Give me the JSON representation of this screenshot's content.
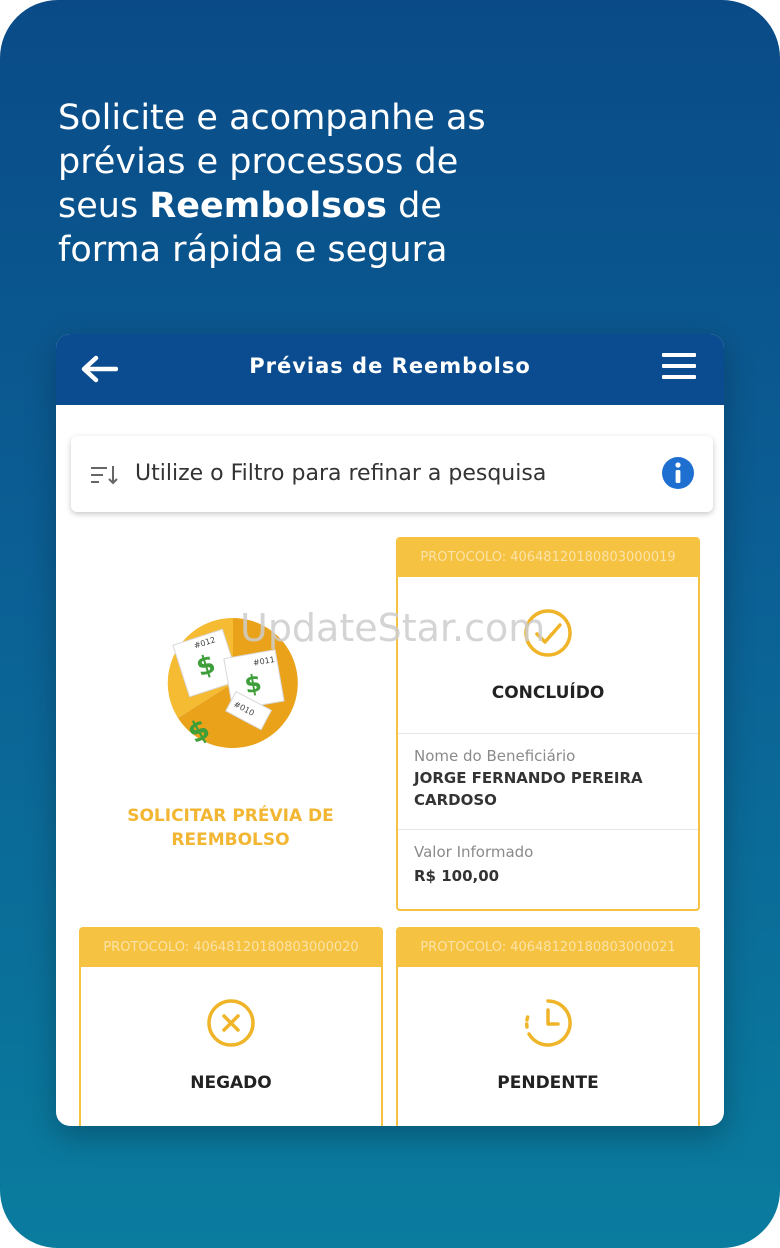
{
  "headline": {
    "line1": "Solicite e acompanhe as",
    "line2": "prévias e processos de",
    "line3_before": "seus ",
    "line3_bold": "Reembolsos",
    "line3_after": " de",
    "line4": "forma rápida e segura"
  },
  "app": {
    "title": "Prévias de Reembolso",
    "back_icon": "arrow-left-icon",
    "menu_icon": "hamburger-menu-icon"
  },
  "filter": {
    "text": "Utilize o Filtro para refinar a pesquisa",
    "sort_icon": "sort-filter-icon",
    "info_icon": "info-icon"
  },
  "request": {
    "label_line1": "SOLICITAR PRÉVIA DE",
    "label_line2": "REEMBOLSO",
    "ticket_numbers": [
      "#012",
      "#011",
      "#010"
    ]
  },
  "cards": {
    "concluded": {
      "protocol": "PROTOCOLO: 40648120180803000019",
      "status": "CONCLUÍDO",
      "beneficiary_label": "Nome do Beneficiário",
      "beneficiary_value": "JORGE FERNANDO PEREIRA CARDOSO",
      "amount_label": "Valor Informado",
      "amount_value": "R$ 100,00"
    },
    "denied": {
      "protocol": "PROTOCOLO: 40648120180803000020",
      "status": "NEGADO"
    },
    "pending": {
      "protocol": "PROTOCOLO: 40648120180803000021",
      "status": "PENDENTE"
    }
  },
  "watermark": "UpdateStar.com",
  "colors": {
    "appbar": "#0a4c8f",
    "accent": "#f5c242",
    "info": "#1f6fd1"
  }
}
